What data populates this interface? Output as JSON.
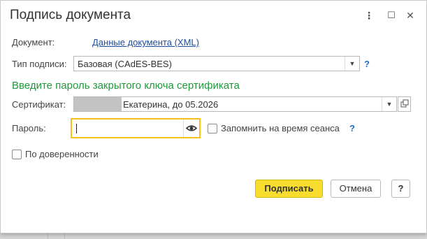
{
  "dialog": {
    "title": "Подпись документа",
    "more_icon": "⋮",
    "maximize_icon": "☐",
    "close_icon": "✕"
  },
  "document": {
    "label": "Документ:",
    "link": "Данные документа (XML)"
  },
  "signature_type": {
    "label": "Тип подписи:",
    "value": "Базовая (CAdES-BES)",
    "help": "?"
  },
  "heading": "Введите пароль закрытого ключа сертификата",
  "certificate": {
    "label": "Сертификат:",
    "value": "Екатерина, до 05.2026"
  },
  "password": {
    "label": "Пароль:",
    "value": "",
    "remember_label": "Запомнить на время сеанса",
    "help": "?"
  },
  "proxy": {
    "label": "По доверенности"
  },
  "buttons": {
    "sign": "Подписать",
    "cancel": "Отмена",
    "help": "?"
  }
}
